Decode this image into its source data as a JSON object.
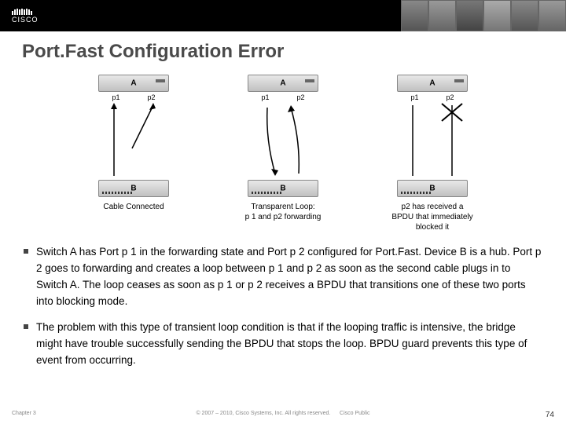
{
  "header": {
    "brand": "CISCO"
  },
  "title": "Port.Fast Configuration Error",
  "diagram": {
    "switch_a": "A",
    "switch_b": "B",
    "p1": "p1",
    "p2": "p2",
    "caption1": "Cable Connected",
    "caption2": "Transparent Loop:\np 1 and p2 forwarding",
    "caption3": "p2 has received a\nBPDU that immediately\nblocked it"
  },
  "bullets": [
    "Switch A has Port p 1 in the forwarding state and Port p 2 configured for Port.Fast. Device B is a hub. Port p 2 goes to forwarding and creates a loop between p 1 and p 2 as soon as the second cable plugs in to Switch A. The loop ceases as soon as p 1 or p 2 receives a BPDU that transitions one of these two ports into blocking mode.",
    "The problem with this type of transient loop condition is that if the looping traffic is intensive, the bridge might have trouble successfully sending the BPDU that stops the loop. BPDU guard prevents this type of event from occurring."
  ],
  "footer": {
    "left": "Chapter 3",
    "center": "© 2007 – 2010, Cisco Systems, Inc. All rights reserved.",
    "right": "Cisco Public",
    "page": "74"
  }
}
